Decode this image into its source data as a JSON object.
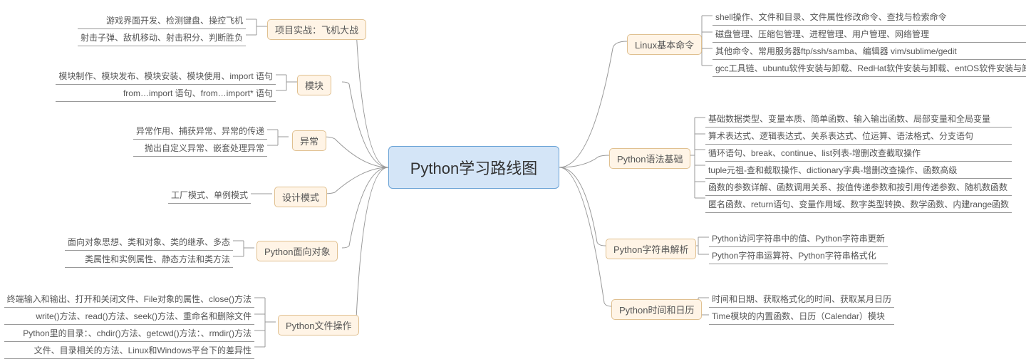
{
  "center": "Python学习路线图",
  "right": [
    {
      "label": "Linux基本命令",
      "leaves": [
        "shell操作、文件和目录、文件属性修改命令、查找与检索命令",
        "磁盘管理、压缩包管理、进程管理、用户管理、网络管理",
        "其他命令、常用服务器ftp/ssh/samba、编辑器 vim/sublime/gedit",
        "gcc工具链、ubuntu软件安装与卸载、RedHat软件安装与卸载、entOS软件安装与卸载"
      ]
    },
    {
      "label": "Python语法基础",
      "leaves": [
        "基础数据类型、变量本质、简单函数、输入输出函数、局部变量和全局变量",
        "算术表达式、逻辑表达式、关系表达式、位运算、语法格式、分支语句",
        "循环语句、break、continue、list列表-增删改查截取操作",
        "tuple元祖-查和截取操作、dictionary字典-增删改查操作、函数高级",
        "函数的参数详解、函数调用关系、按值传递参数和按引用传递参数、随机数函数",
        "匿名函数、return语句、变量作用域、数字类型转换、数学函数、内建range函数"
      ]
    },
    {
      "label": "Python字符串解析",
      "leaves": [
        "Python访问字符串中的值、Python字符串更新",
        "Python字符串运算符、Python字符串格式化"
      ]
    },
    {
      "label": "Python时间和日历",
      "leaves": [
        "时间和日期、获取格式化的时间、获取某月日历",
        "Time模块的内置函数、日历（Calendar）模块"
      ]
    }
  ],
  "left": [
    {
      "label": "项目实战：飞机大战",
      "leaves": [
        "游戏界面开发、检测键盘、操控飞机",
        "射击子弹、敌机移动、射击积分、判断胜负"
      ]
    },
    {
      "label": "模块",
      "leaves": [
        "模块制作、模块发布、模块安装、模块使用、import 语句",
        "from…import 语句、from…import* 语句"
      ]
    },
    {
      "label": "异常",
      "leaves": [
        "异常作用、捕获异常、异常的传递",
        "抛出自定义异常、嵌套处理异常"
      ]
    },
    {
      "label": "设计模式",
      "leaves": [
        "工厂模式、单例模式"
      ]
    },
    {
      "label": "Python面向对象",
      "leaves": [
        "面向对象思想、类和对象、类的继承、多态",
        "类属性和实例属性、静态方法和类方法"
      ]
    },
    {
      "label": "Python文件操作",
      "leaves": [
        "终端输入和输出、打开和关闭文件、File对象的属性、close()方法",
        "write()方法、read()方法、seek()方法、重命名和删除文件",
        "Python里的目录：、chdir()方法、getcwd()方法：、rmdir()方法",
        "文件、目录相关的方法、Linux和Windows平台下的差异性"
      ]
    }
  ]
}
